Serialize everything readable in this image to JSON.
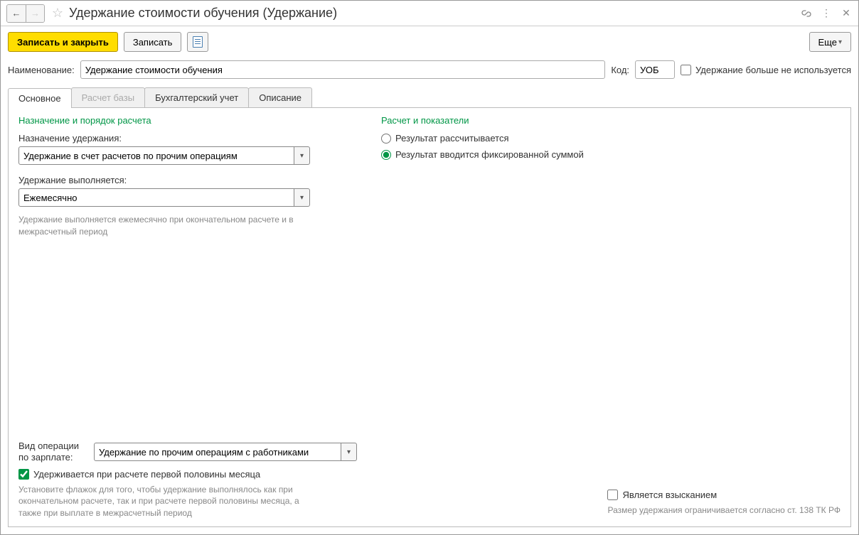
{
  "title": "Удержание стоимости обучения (Удержание)",
  "toolbar": {
    "save_close": "Записать и закрыть",
    "save": "Записать",
    "more": "Еще"
  },
  "form": {
    "name_label": "Наименование:",
    "name_value": "Удержание стоимости обучения",
    "code_label": "Код:",
    "code_value": "УОБ",
    "not_used_label": "Удержание больше не используется"
  },
  "tabs": {
    "main": "Основное",
    "base": "Расчет базы",
    "acc": "Бухгалтерский учет",
    "desc": "Описание"
  },
  "left": {
    "section": "Назначение и порядок расчета",
    "purpose_label": "Назначение удержания:",
    "purpose_value": "Удержание в счет расчетов по прочим операциям",
    "exec_label": "Удержание выполняется:",
    "exec_value": "Ежемесячно",
    "exec_hint": "Удержание выполняется ежемесячно при окончательном расчете и в межрасчетный период",
    "salary_label": "Вид операции по зарплате:",
    "salary_value": "Удержание по прочим операциям с работниками",
    "first_half": "Удерживается при расчете первой половины месяца",
    "first_half_hint": "Установите флажок для того, чтобы удержание выполнялось как при окончательном расчете, так и при расчете первой половины месяца, а также при выплате в межрасчетный период"
  },
  "right": {
    "section": "Расчет и показатели",
    "radio_calc": "Результат рассчитывается",
    "radio_fixed": "Результат вводится фиксированной суммой",
    "is_recovery": "Является взысканием",
    "recovery_hint": "Размер удержания ограничивается согласно ст. 138 ТК РФ"
  }
}
